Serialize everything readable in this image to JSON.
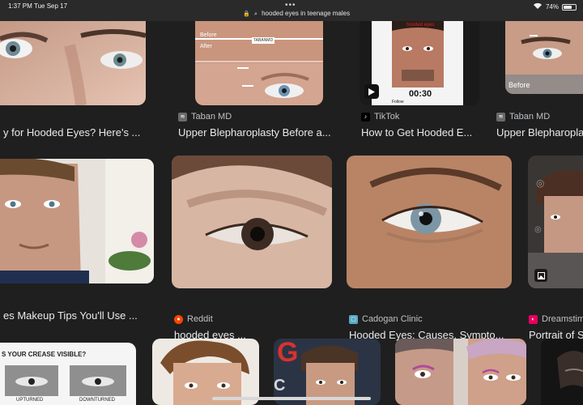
{
  "status": {
    "time": "1:37 PM",
    "date": "Tue Sep 17",
    "url_text": "hooded eyes in teenage males",
    "battery": "74%",
    "battery_level": 0.74
  },
  "results": [
    {
      "source": "",
      "caption": "y for Hooded Eyes? Here's ..."
    },
    {
      "source": "Taban MD",
      "caption": "Upper Blepharoplasty Before a...",
      "overlay": [
        "Before",
        "After",
        "TABANMD"
      ]
    },
    {
      "source": "TikTok",
      "caption": "How to Get Hooded E...",
      "overlay": [
        "hooded eyes",
        "00:30",
        "Follow"
      ]
    },
    {
      "source": "Taban MD",
      "caption": "Upper Blepharopla",
      "overlay": [
        "Before"
      ]
    },
    {
      "source": "",
      "caption": "es Makeup Tips You'll Use ..."
    },
    {
      "source": "Reddit",
      "caption": "hooded eyes ..."
    },
    {
      "source": "Cadogan Clinic",
      "caption": "Hooded Eyes: Causes, Sympto..."
    },
    {
      "source": "Dreamstim",
      "caption": "Portrait of S"
    },
    {
      "source": "",
      "caption": "",
      "overlay": [
        "S YOUR CREASE VISIBLE?",
        "UPTURNED",
        "DOWNTURNED"
      ]
    }
  ],
  "colors": {
    "background": "#1f1f1f",
    "reddit": "#ff4500",
    "dreamstime": "#e6005c",
    "cadogan": "#5aa7c7"
  },
  "icons": {
    "play": "play-icon",
    "image": "image-icon"
  }
}
